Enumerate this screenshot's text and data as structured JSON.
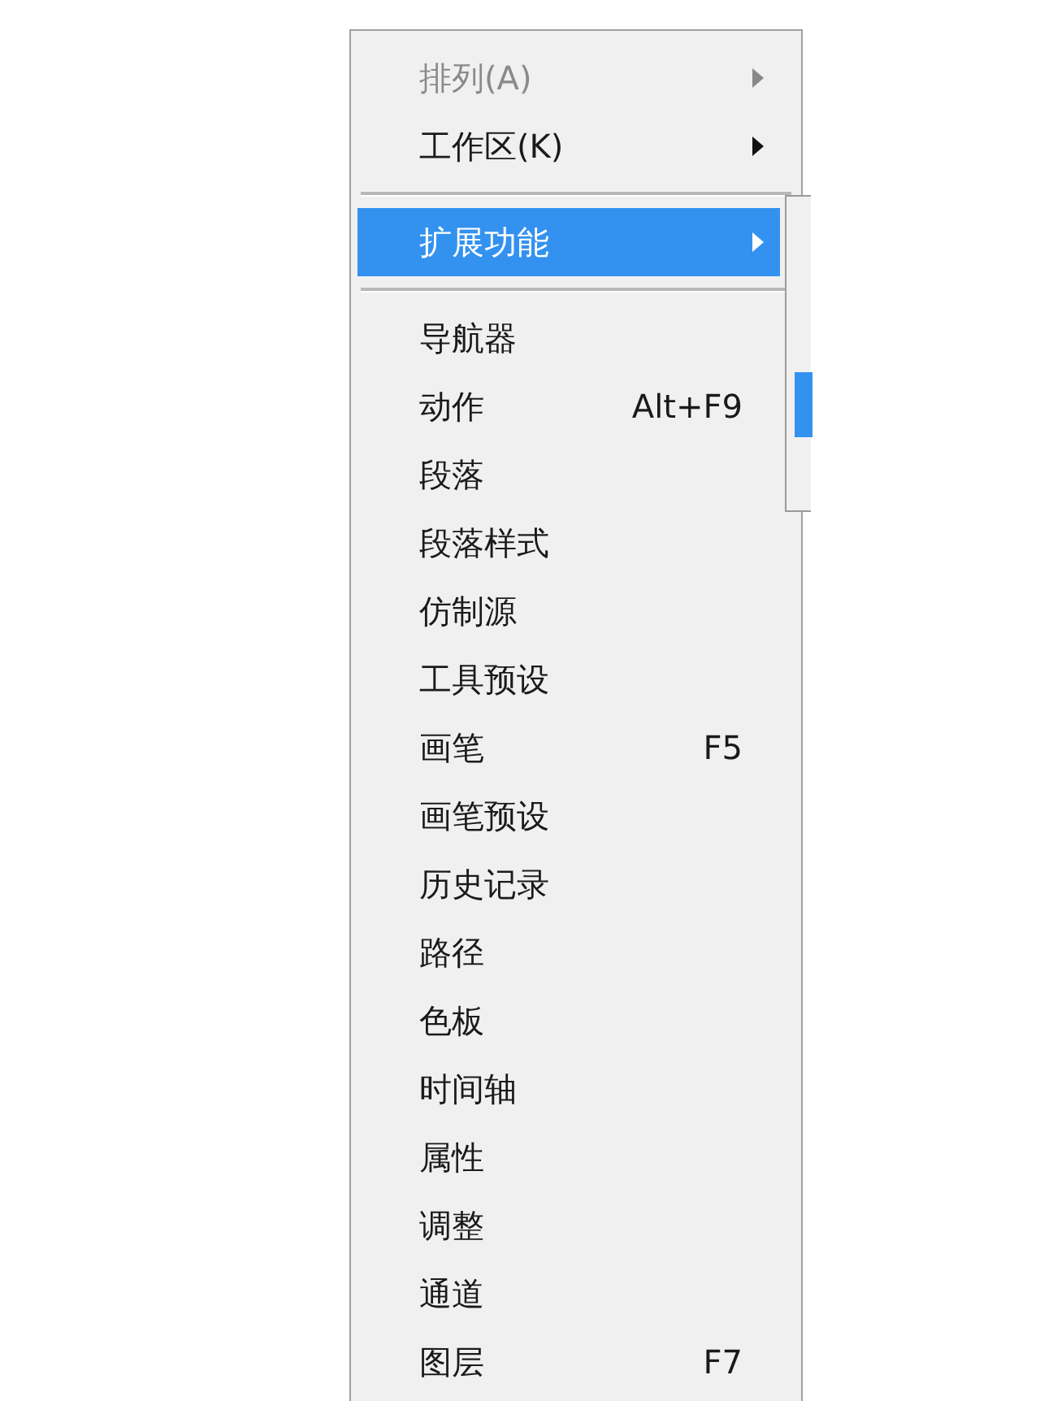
{
  "menu": {
    "items": [
      {
        "kind": "item",
        "label": "排列(A)",
        "submenu": true,
        "disabled": true,
        "selected": false
      },
      {
        "kind": "item",
        "label": "工作区(K)",
        "submenu": true,
        "disabled": false,
        "selected": false
      },
      {
        "kind": "separator"
      },
      {
        "kind": "item",
        "label": "扩展功能",
        "submenu": true,
        "disabled": false,
        "selected": true
      },
      {
        "kind": "separator"
      },
      {
        "kind": "item",
        "label": "导航器",
        "submenu": false,
        "disabled": false,
        "selected": false
      },
      {
        "kind": "item",
        "label": "动作",
        "shortcut": "Alt+F9",
        "submenu": false,
        "disabled": false,
        "selected": false
      },
      {
        "kind": "item",
        "label": "段落",
        "submenu": false,
        "disabled": false,
        "selected": false
      },
      {
        "kind": "item",
        "label": "段落样式",
        "submenu": false,
        "disabled": false,
        "selected": false
      },
      {
        "kind": "item",
        "label": "仿制源",
        "submenu": false,
        "disabled": false,
        "selected": false
      },
      {
        "kind": "item",
        "label": "工具预设",
        "submenu": false,
        "disabled": false,
        "selected": false
      },
      {
        "kind": "item",
        "label": "画笔",
        "shortcut": "F5",
        "submenu": false,
        "disabled": false,
        "selected": false
      },
      {
        "kind": "item",
        "label": "画笔预设",
        "submenu": false,
        "disabled": false,
        "selected": false
      },
      {
        "kind": "item",
        "label": "历史记录",
        "submenu": false,
        "disabled": false,
        "selected": false
      },
      {
        "kind": "item",
        "label": "路径",
        "submenu": false,
        "disabled": false,
        "selected": false
      },
      {
        "kind": "item",
        "label": "色板",
        "submenu": false,
        "disabled": false,
        "selected": false
      },
      {
        "kind": "item",
        "label": "时间轴",
        "submenu": false,
        "disabled": false,
        "selected": false
      },
      {
        "kind": "item",
        "label": "属性",
        "submenu": false,
        "disabled": false,
        "selected": false
      },
      {
        "kind": "item",
        "label": "调整",
        "submenu": false,
        "disabled": false,
        "selected": false
      },
      {
        "kind": "item",
        "label": "通道",
        "submenu": false,
        "disabled": false,
        "selected": false
      },
      {
        "kind": "item",
        "label": "图层",
        "shortcut": "F7",
        "submenu": false,
        "disabled": false,
        "selected": false
      }
    ]
  }
}
